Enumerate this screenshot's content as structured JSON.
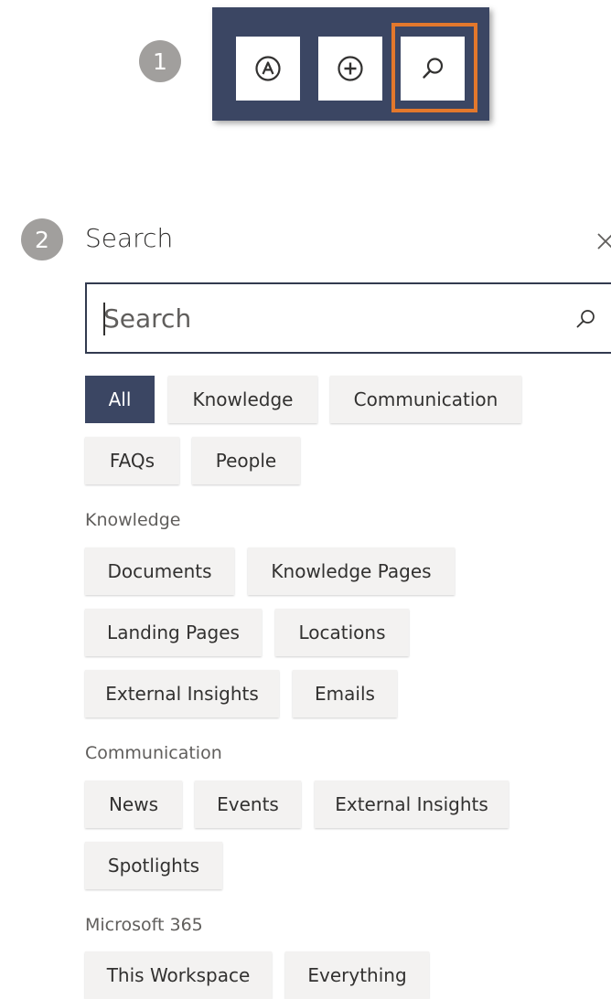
{
  "steps": {
    "one": "1",
    "two": "2"
  },
  "toolbar": {
    "buttons": [
      {
        "icon": "a-circle-icon"
      },
      {
        "icon": "plus-circle-icon"
      },
      {
        "icon": "search-icon"
      }
    ],
    "highlight_color": "#e3782c",
    "background": "#3b4663"
  },
  "panel": {
    "title": "Search",
    "close_icon": "close-icon",
    "search": {
      "placeholder": "Search",
      "value": ""
    }
  },
  "filters": {
    "scopes": [
      "All",
      "Knowledge",
      "Communication",
      "FAQs",
      "People"
    ],
    "active": "All"
  },
  "sections": [
    {
      "label": "Knowledge",
      "items": [
        "Documents",
        "Knowledge Pages",
        "Landing Pages",
        "Locations",
        "External Insights",
        "Emails"
      ]
    },
    {
      "label": "Communication",
      "items": [
        "News",
        "Events",
        "External Insights",
        "Spotlights"
      ]
    },
    {
      "label": "Microsoft 365",
      "items": [
        "This Workspace",
        "Everything"
      ]
    }
  ],
  "colors": {
    "accent": "#3b4663",
    "chip_bg": "#f3f2f1",
    "badge": "#a19f9d"
  }
}
